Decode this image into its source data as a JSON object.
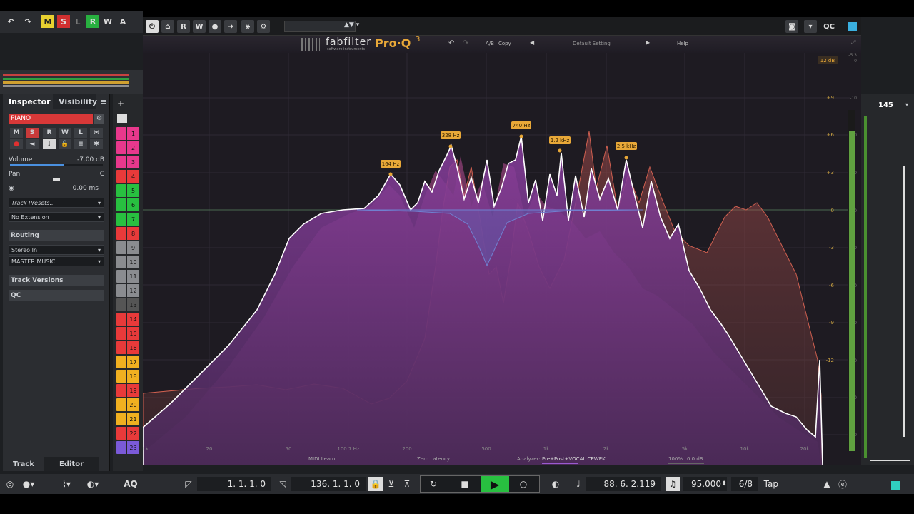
{
  "daw_toolbar": {
    "m": "M",
    "s": "S",
    "l": "L",
    "r": "R",
    "w": "W",
    "a": "A"
  },
  "inspector": {
    "tab_inspector": "Inspector",
    "tab_visibility": "Visibility",
    "track_name": "PIANO",
    "volume_label": "Volume",
    "volume_value": "-7.00 dB",
    "pan_label": "Pan",
    "pan_value": "C",
    "delay_value": "0.00 ms",
    "track_presets": "Track Presets...",
    "extension": "No Extension",
    "routing": "Routing",
    "input": "Stereo In",
    "output": "MASTER MUSIC",
    "track_versions": "Track Versions",
    "qc": "QC",
    "bottom_tab_track": "Track",
    "bottom_tab_editor": "Editor",
    "buttons": {
      "m": "M",
      "s": "S",
      "r": "R",
      "w": "W",
      "l": "L"
    }
  },
  "tracks": [
    {
      "num": "1",
      "color": "#e8388c"
    },
    {
      "num": "2",
      "color": "#e8388c"
    },
    {
      "num": "3",
      "color": "#e8388c"
    },
    {
      "num": "4",
      "color": "#e83a3a"
    },
    {
      "num": "5",
      "color": "#28c040"
    },
    {
      "num": "6",
      "color": "#28c040"
    },
    {
      "num": "7",
      "color": "#28c040"
    },
    {
      "num": "8",
      "color": "#e83a3a"
    },
    {
      "num": "9",
      "color": "#8a8c90"
    },
    {
      "num": "10",
      "color": "#8a8c90"
    },
    {
      "num": "11",
      "color": "#8a8c90"
    },
    {
      "num": "12",
      "color": "#8a8c90"
    },
    {
      "num": "13",
      "color": "#555"
    },
    {
      "num": "14",
      "color": "#e83a3a"
    },
    {
      "num": "15",
      "color": "#e83a3a"
    },
    {
      "num": "16",
      "color": "#e83a3a"
    },
    {
      "num": "17",
      "color": "#f0b020"
    },
    {
      "num": "18",
      "color": "#f0b020"
    },
    {
      "num": "19",
      "color": "#e83a3a"
    },
    {
      "num": "20",
      "color": "#f0b020"
    },
    {
      "num": "21",
      "color": "#f0b020"
    },
    {
      "num": "22",
      "color": "#e83a3a"
    },
    {
      "num": "23",
      "color": "#7a5ad8"
    }
  ],
  "plugin_bar": {
    "r": "R",
    "w": "W",
    "qc": "QC"
  },
  "eq": {
    "brand": "fabfilter",
    "brand_sub": "software instruments",
    "product": "Pro·Q",
    "product_version": "3",
    "ab": "A/B",
    "copy": "Copy",
    "preset": "Default Setting",
    "help": "Help",
    "range": "12 dB",
    "band_labels": [
      "164 Hz",
      "328 Hz",
      "740 Hz",
      "1.2 kHz",
      "2.5 kHz"
    ],
    "db_scale": [
      "+9",
      "+6",
      "+3",
      "0",
      "-3",
      "-6",
      "-9",
      "-12"
    ],
    "analyzer_scale": [
      "-10",
      "-20",
      "-30",
      "-40",
      "-50",
      "-60",
      "-70",
      "-80",
      "-90",
      "-100"
    ],
    "top_right_scale": [
      "-5.3",
      "0"
    ],
    "freq_labels": [
      "50",
      "100.7 Hz",
      "200",
      "500",
      "1k",
      "2k",
      "5k",
      "10k",
      "20k"
    ],
    "left_freq": "20",
    "corner": "Lk",
    "midi_learn": "MIDI Learn",
    "latency": "Zero Latency",
    "analyzer_label": "Analyzer:",
    "analyzer_mode": "Pre+Post+VOCAL CEWEK",
    "zoom": "100%",
    "gain": "0.0 dB"
  },
  "meters": {
    "tempo_value": "145"
  },
  "transport": {
    "left_locator": "1. 1. 1.  0",
    "right_locator": "136. 1. 1.  0",
    "position": "88. 6. 2.119",
    "tempo": "95.000",
    "signature": "6/8",
    "tap": "Tap",
    "aq": "AQ"
  }
}
